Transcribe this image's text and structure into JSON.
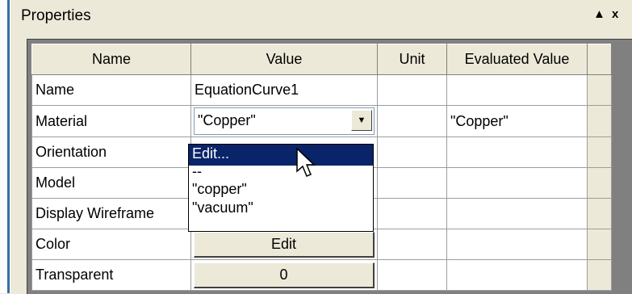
{
  "panel": {
    "title": "Properties",
    "pin_glyph": "▲",
    "close_glyph": "x"
  },
  "columns": [
    "Name",
    "Value",
    "Unit",
    "Evaluated Value",
    ""
  ],
  "rows": [
    {
      "name": "Name",
      "value": "EquationCurve1",
      "unit": "",
      "evaluated": ""
    },
    {
      "name": "Material",
      "value": "\"Copper\"",
      "unit": "",
      "evaluated": "\"Copper\""
    },
    {
      "name": "Orientation",
      "value": "",
      "unit": "",
      "evaluated": ""
    },
    {
      "name": "Model",
      "value": "",
      "unit": "",
      "evaluated": ""
    },
    {
      "name": "Display Wireframe",
      "value": "",
      "unit": "",
      "evaluated": ""
    },
    {
      "name": "Color",
      "value": "Edit",
      "unit": "",
      "evaluated": ""
    },
    {
      "name": "Transparent",
      "value": "0",
      "unit": "",
      "evaluated": ""
    }
  ],
  "dropdown": {
    "options": [
      "Edit...",
      "--",
      "\"copper\"",
      "\"vacuum\""
    ],
    "selected_index": 0
  },
  "colors": {
    "selection": "#0a246a",
    "panel_bg": "#ece9d8",
    "grid_bg": "#808080"
  }
}
